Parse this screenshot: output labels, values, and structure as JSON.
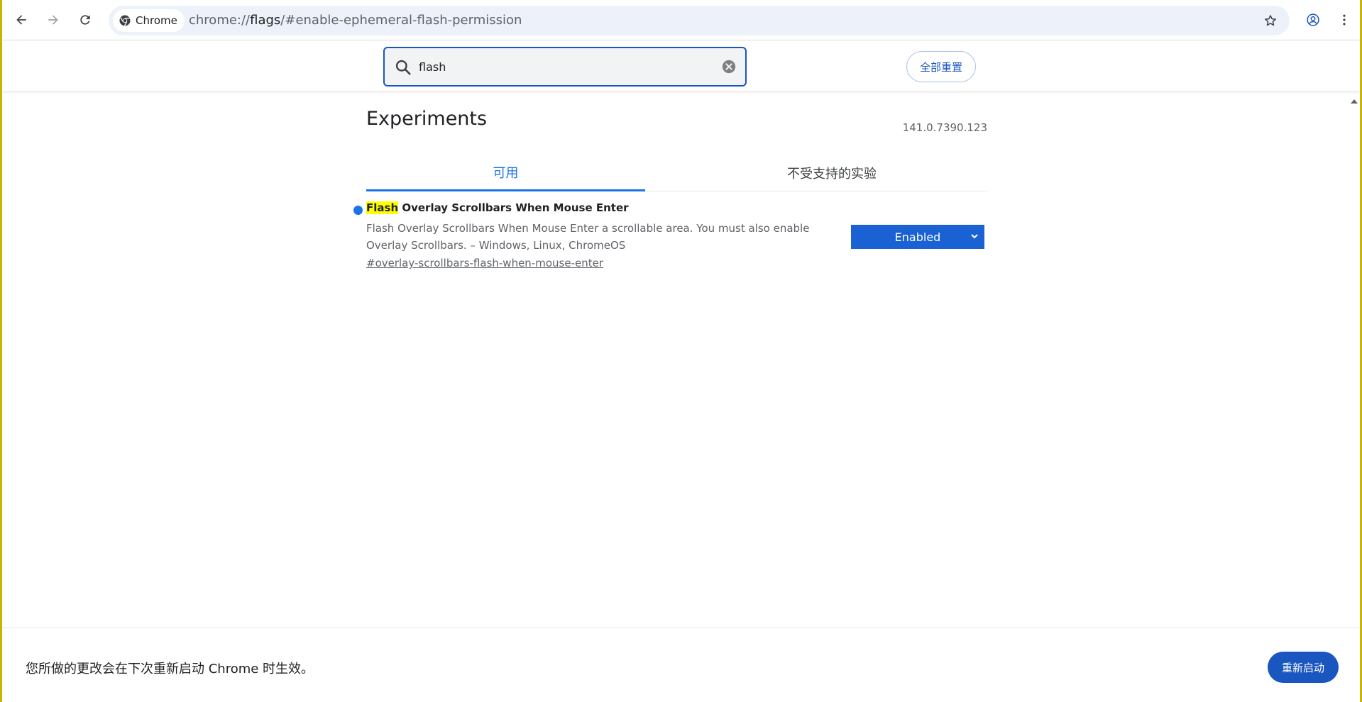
{
  "toolbar": {
    "chip_label": "Chrome",
    "url_prefix": "chrome://",
    "url_host": "flags",
    "url_path": "/#enable-ephemeral-flash-permission"
  },
  "search": {
    "value": "flash",
    "reset_label": "全部重置"
  },
  "page": {
    "title": "Experiments",
    "version": "141.0.7390.123",
    "tabs": [
      {
        "label": "可用",
        "active": true
      },
      {
        "label": "不受支持的实验",
        "active": false
      }
    ]
  },
  "flag": {
    "name_highlight": "Flash",
    "name_rest": " Overlay Scrollbars When Mouse Enter",
    "description": "Flash Overlay Scrollbars When Mouse Enter a scrollable area. You must also enable Overlay Scrollbars. – Windows, Linux, ChromeOS",
    "link": "#overlay-scrollbars-flash-when-mouse-enter",
    "selected": "Enabled"
  },
  "bottom": {
    "message": "您所做的更改会在下次重新启动 Chrome 时生效。",
    "restart_label": "重新启动"
  },
  "colors": {
    "accent": "#1a73e8",
    "button_blue": "#1a56c0",
    "select_blue": "#1a62d3",
    "highlight": "#ffff00",
    "frame_border": "#c9b400"
  }
}
